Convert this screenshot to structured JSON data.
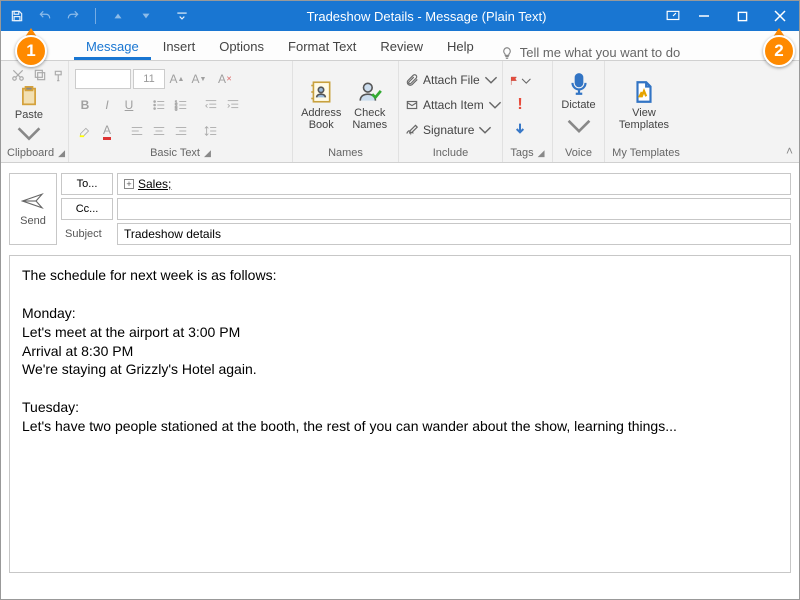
{
  "title": "Tradeshow Details - Message (Plain Text)",
  "tabs": [
    "Message",
    "Insert",
    "Options",
    "Format Text",
    "Review",
    "Help"
  ],
  "tell": "Tell me what you want to do",
  "groups": {
    "clipboard": "Clipboard",
    "basictext": "Basic Text",
    "names": "Names",
    "include": "Include",
    "tags": "Tags",
    "voice": "Voice",
    "mytemplates": "My Templates"
  },
  "paste": "Paste",
  "addressbook": "Address\nBook",
  "checknames": "Check\nNames",
  "attachfile": "Attach File",
  "attachitem": "Attach Item",
  "signature": "Signature",
  "dictate": "Dictate",
  "viewtemplates": "View\nTemplates",
  "font": {
    "size": "11"
  },
  "send": "Send",
  "fields": {
    "to": "To...",
    "cc": "Cc...",
    "subject": "Subject"
  },
  "recipients": {
    "to": "Sales;"
  },
  "subject_value": "Tradeshow details",
  "body": [
    "The schedule for next week is as follows:",
    "",
    "Monday:",
    "Let's meet at the airport at 3:00 PM",
    "Arrival at 8:30 PM",
    "We're staying at Grizzly's Hotel again.",
    "",
    "Tuesday:",
    "Let's have two people stationed at the booth, the rest of you can wander about the show, learning things..."
  ],
  "callouts": {
    "c1": "1",
    "c2": "2"
  }
}
